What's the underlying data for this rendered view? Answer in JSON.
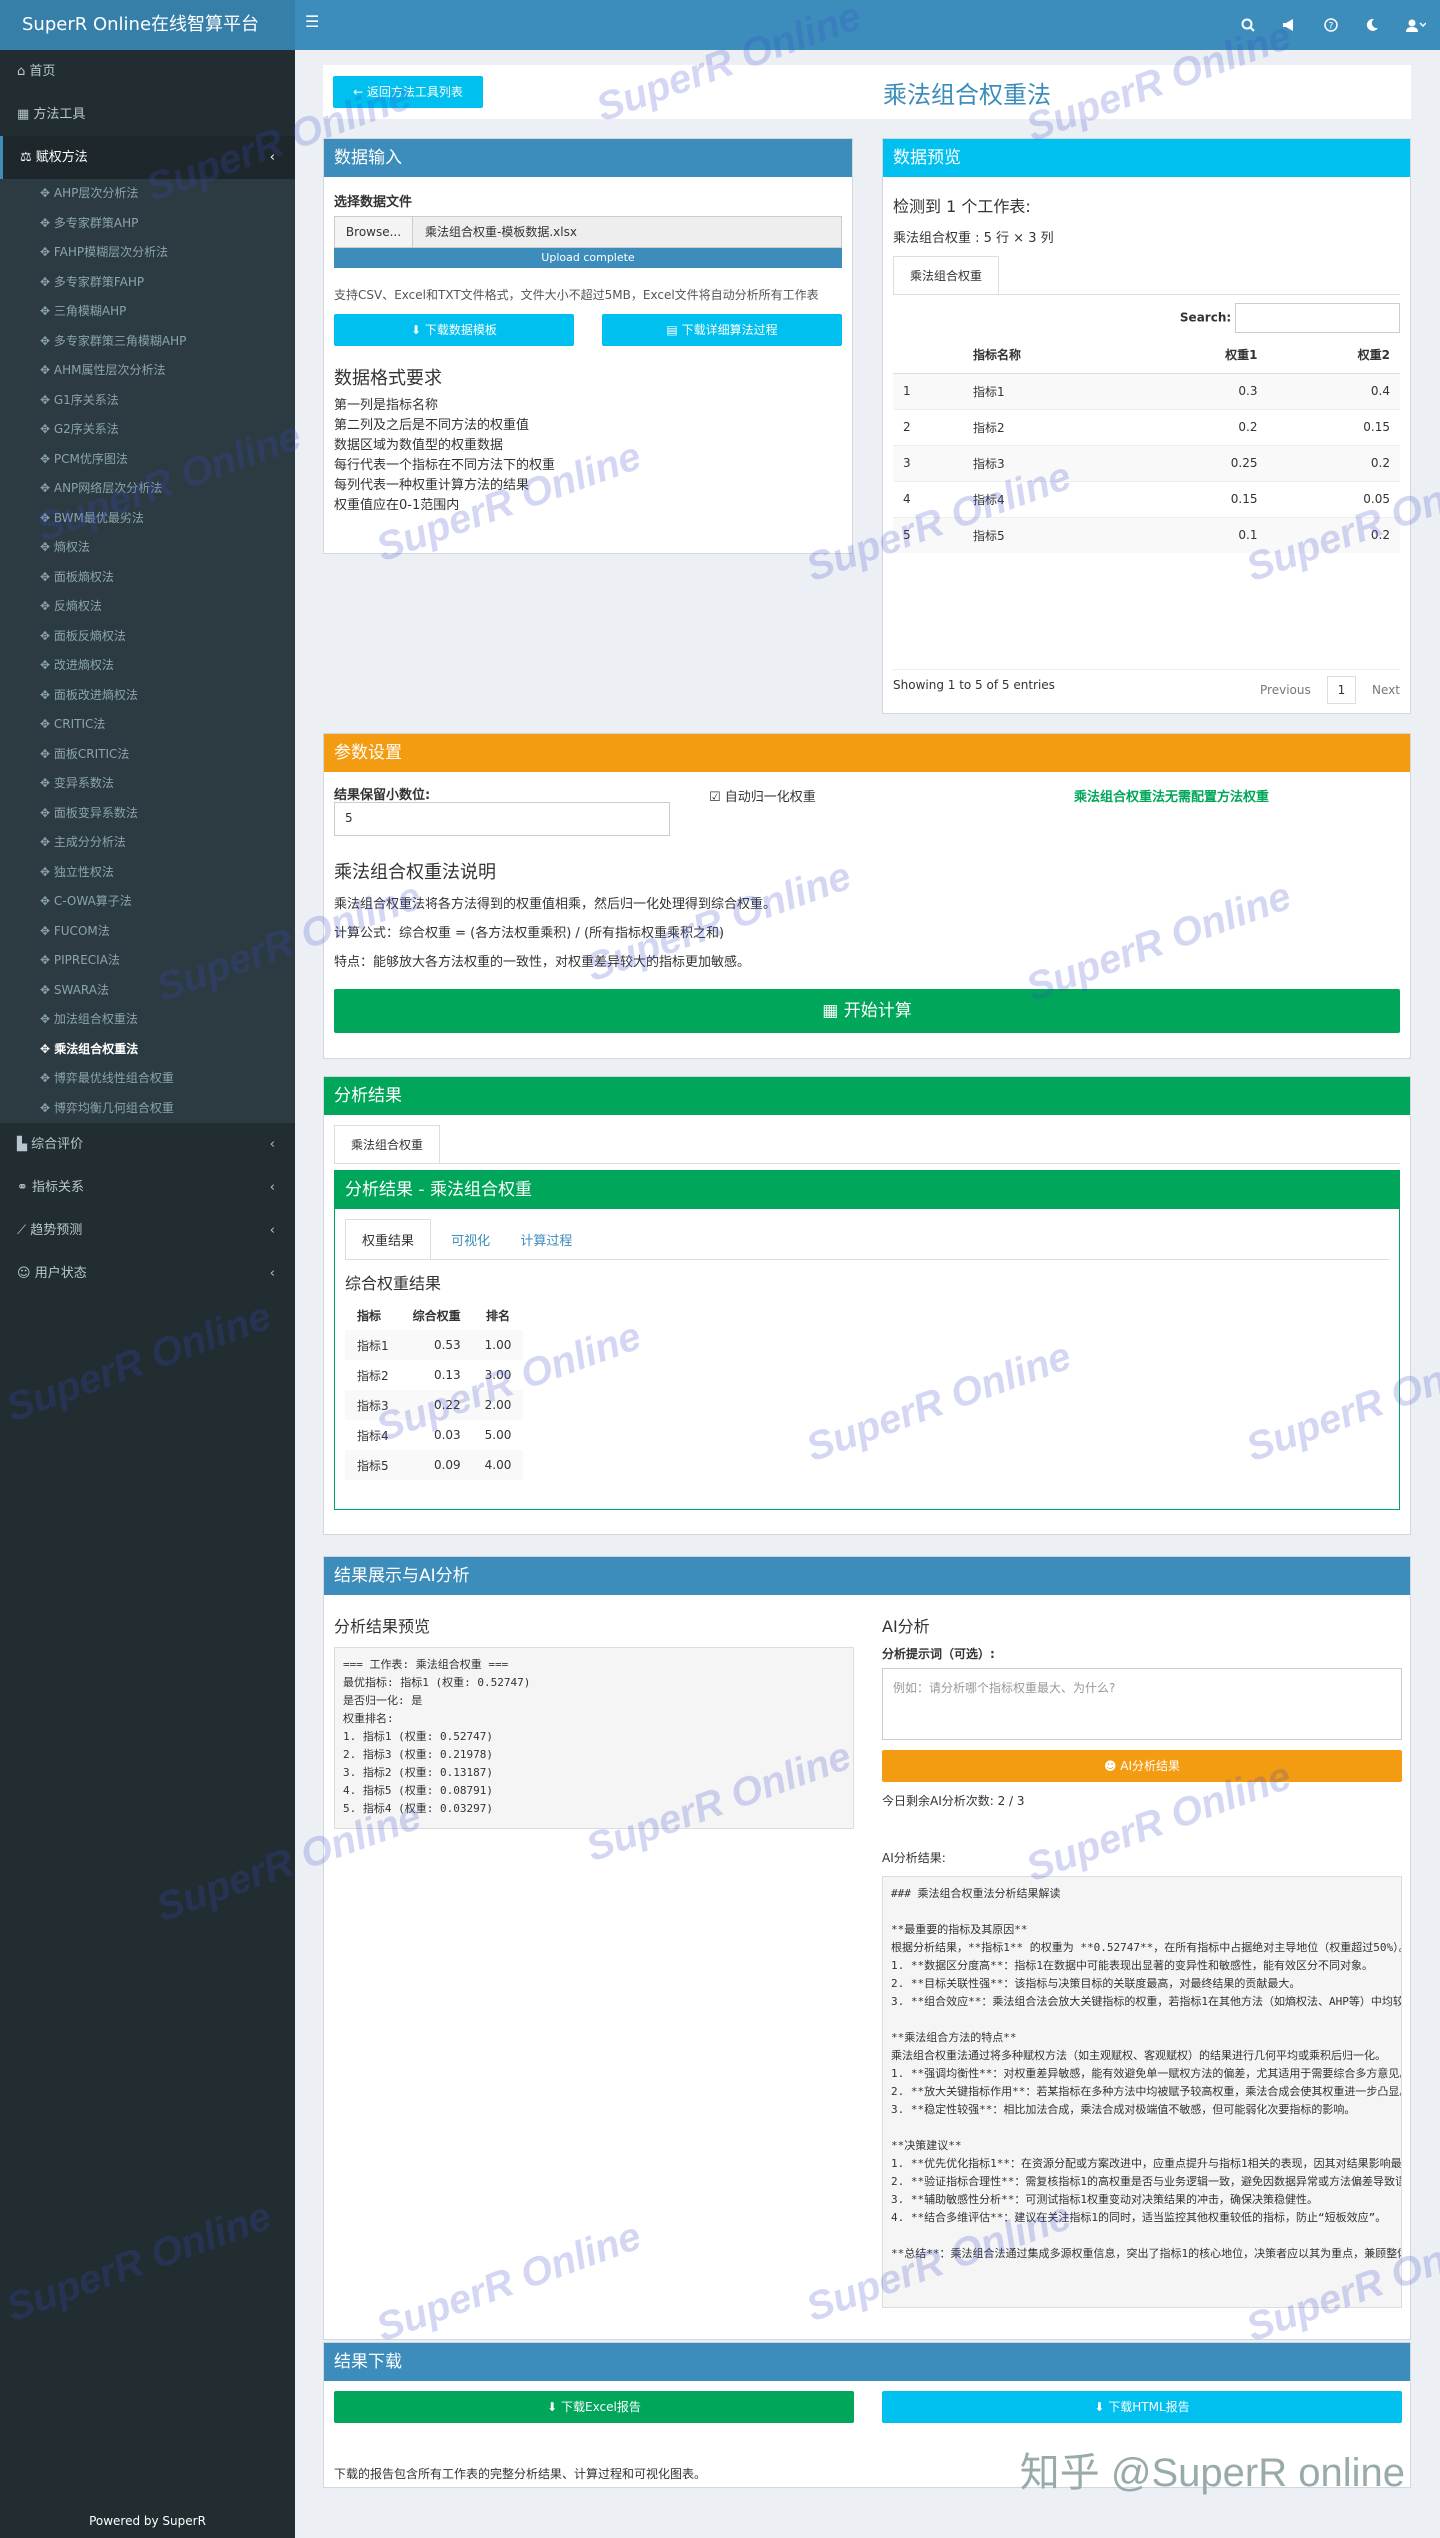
{
  "app": {
    "title": "SuperR Online在线智算平台",
    "menu_icon": "☰"
  },
  "topbar_icons": [
    "search-icon",
    "megaphone-icon",
    "help-icon",
    "moon-icon",
    "user-menu-icon"
  ],
  "sidebar": {
    "items_top": [
      {
        "icon": "home",
        "label": "首页"
      },
      {
        "icon": "grid",
        "label": "方法工具"
      },
      {
        "icon": "scale",
        "label": "赋权方法",
        "arrow": "‹"
      }
    ],
    "sub": [
      "AHP层次分析法",
      "多专家群策AHP",
      "FAHP模糊层次分析法",
      "多专家群策FAHP",
      "三角模糊AHP",
      "多专家群策三角模糊AHP",
      "AHM属性层次分析法",
      "G1序关系法",
      "G2序关系法",
      "PCM优序图法",
      "ANP网络层次分析法",
      "BWM最优最劣法",
      "熵权法",
      "面板熵权法",
      "反熵权法",
      "面板反熵权法",
      "改进熵权法",
      "面板改进熵权法",
      "CRITIC法",
      "面板CRITIC法",
      "变异系数法",
      "面板变异系数法",
      "主成分分析法",
      "独立性权法",
      "C-OWA算子法",
      "FUCOM法",
      "PIPRECIA法",
      "SWARA法",
      "加法组合权重法",
      "乘法组合权重法",
      "博弈最优线性组合权重",
      "博弈均衡几何组合权重"
    ],
    "active_sub": "乘法组合权重法",
    "items_bottom": [
      {
        "label": "综合评价",
        "arrow": "‹"
      },
      {
        "label": "指标关系",
        "arrow": "‹"
      },
      {
        "label": "趋势预测",
        "arrow": "‹"
      },
      {
        "label": "用户状态",
        "arrow": "‹"
      }
    ],
    "powered": "Powered by SuperR"
  },
  "header": {
    "back_label": "← 返回方法工具列表",
    "title": "乘法组合权重法"
  },
  "data_input": {
    "title": "数据输入",
    "file_label": "选择数据文件",
    "browse": "Browse...",
    "file_name": "乘法组合权重-模板数据.xlsx",
    "upload_status": "Upload complete",
    "hint": "支持CSV、Excel和TXT文件格式，文件大小不超过5MB，Excel文件将自动分析所有工作表",
    "download_template": "下载数据模板",
    "download_algo": "下载详细算法过程",
    "format_title": "数据格式要求",
    "format_lines": [
      "第一列是指标名称",
      "第二列及之后是不同方法的权重值",
      "数据区域为数值型的权重数据",
      "每行代表一个指标在不同方法下的权重",
      "每列代表一种权重计算方法的结果",
      "权重值应在0-1范围内"
    ]
  },
  "preview": {
    "title": "数据预览",
    "detected": "检测到 1 个工作表:",
    "sheet_info": "乘法组合权重 : 5 行 × 3 列",
    "tab": "乘法组合权重",
    "search_label": "Search:",
    "columns": [
      "",
      "指标名称",
      "权重1",
      "权重2"
    ],
    "rows": [
      [
        "1",
        "指标1",
        "0.3",
        "0.4"
      ],
      [
        "2",
        "指标2",
        "0.2",
        "0.15"
      ],
      [
        "3",
        "指标3",
        "0.25",
        "0.2"
      ],
      [
        "4",
        "指标4",
        "0.15",
        "0.05"
      ],
      [
        "5",
        "指标5",
        "0.1",
        "0.2"
      ]
    ],
    "showing": "Showing 1 to 5 of 5 entries",
    "prev": "Previous",
    "page": "1",
    "next": "Next"
  },
  "params": {
    "title": "参数设置",
    "decimal_label": "结果保留小数位:",
    "decimal_value": "5",
    "normalize_label": "自动归一化权重",
    "note": "乘法组合权重法无需配置方法权重",
    "desc_title": "乘法组合权重法说明",
    "desc1": "乘法组合权重法将各方法得到的权重值相乘，然后归一化处理得到综合权重。",
    "desc2": "计算公式：综合权重 = (各方法权重乘积) / (所有指标权重乘积之和)",
    "desc3": "特点：能够放大各方法权重的一致性，对权重差异较大的指标更加敏感。",
    "start": "开始计算"
  },
  "results": {
    "title": "分析结果",
    "outer_tab": "乘法组合权重",
    "inner_title": "分析结果 - 乘法组合权重",
    "tabs": [
      "权重结果",
      "可视化",
      "计算过程"
    ],
    "section": "综合权重结果",
    "columns": [
      "指标",
      "综合权重",
      "排名"
    ],
    "rows": [
      [
        "指标1",
        "0.53",
        "1.00"
      ],
      [
        "指标2",
        "0.13",
        "3.00"
      ],
      [
        "指标3",
        "0.22",
        "2.00"
      ],
      [
        "指标4",
        "0.03",
        "5.00"
      ],
      [
        "指标5",
        "0.09",
        "4.00"
      ]
    ]
  },
  "ai": {
    "title": "结果展示与AI分析",
    "preview_title": "分析结果预览",
    "preview_text": "=== 工作表: 乘法组合权重 ===\n最优指标: 指标1 (权重: 0.52747)\n是否归一化: 是\n权重排名:\n1. 指标1 (权重: 0.52747)\n2. 指标3 (权重: 0.21978)\n3. 指标2 (权重: 0.13187)\n4. 指标5 (权重: 0.08791)\n5. 指标4 (权重: 0.03297)",
    "ai_title": "AI分析",
    "prompt_label": "分析提示词（可选）:",
    "prompt_placeholder": "例如：请分析哪个指标权重最大、为什么?",
    "ai_button": "AI分析结果",
    "remaining": "今日剩余AI分析次数: 2 / 3",
    "result_label": "AI分析结果:",
    "result_text": "### 乘法组合权重法分析结果解读\n\n**最重要的指标及其原因**\n根据分析结果，**指标1** 的权重为 **0.52747**，在所有指标中占据绝对主导地位（权重超过50%）。\n1. **数据区分度高**：指标1在数据中可能表现出显著的变异性和敏感性，能有效区分不同对象。\n2. **目标关联性强**：该指标与决策目标的关联度最高，对最终结果的贡献最大。\n3. **组合效应**：乘法组合法会放大关键指标的权重，若指标1在其他方法（如熵权法、AHP等）中均较高。\n\n**乘法组合方法的特点**\n乘法组合权重法通过将多种赋权方法（如主观赋权、客观赋权）的结果进行几何平均或乘积后归一化。\n1. **强调均衡性**：对权重差异敏感，能有效避免单一赋权方法的偏差，尤其适用于需要综合多方意见。\n2. **放大关键指标作用**：若某指标在多种方法中均被赋予较高权重，乘法合成会使其权重进一步凸显。\n3. **稳定性较强**：相比加法合成，乘法合成对极端值不敏感，但可能弱化次要指标的影响。\n\n**决策建议**\n1. **优先优化指标1**：在资源分配或方案改进中，应重点提升与指标1相关的表现，因其对结果影响最大。\n2. **验证指标合理性**：需复核指标1的高权重是否与业务逻辑一致，避免因数据异常或方法偏差导致误判。\n3. **辅助敏感性分析**：可测试指标1权重变动对决策结果的冲击，确保决策稳健性。\n4. **结合多维评估**：建议在关注指标1的同时，适当监控其他权重较低的指标，防止“短板效应”。\n\n**总结**：乘法组合法通过集成多源权重信息，突出了指标1的核心地位，决策者应以其为重点，兼顾整体。"
  },
  "download": {
    "title": "结果下载",
    "excel": "下载Excel报告",
    "html": "下载HTML报告",
    "note": "下载的报告包含所有工作表的完整分析结果、计算过程和可视化图表。"
  },
  "watermark": "SuperR Online",
  "zhihu": "知乎 @SuperR online",
  "colors": {
    "primary": "#3c8dbc",
    "info": "#00c0ef",
    "warning": "#f39c12",
    "success": "#00a65a",
    "sidebar": "#222d32"
  }
}
